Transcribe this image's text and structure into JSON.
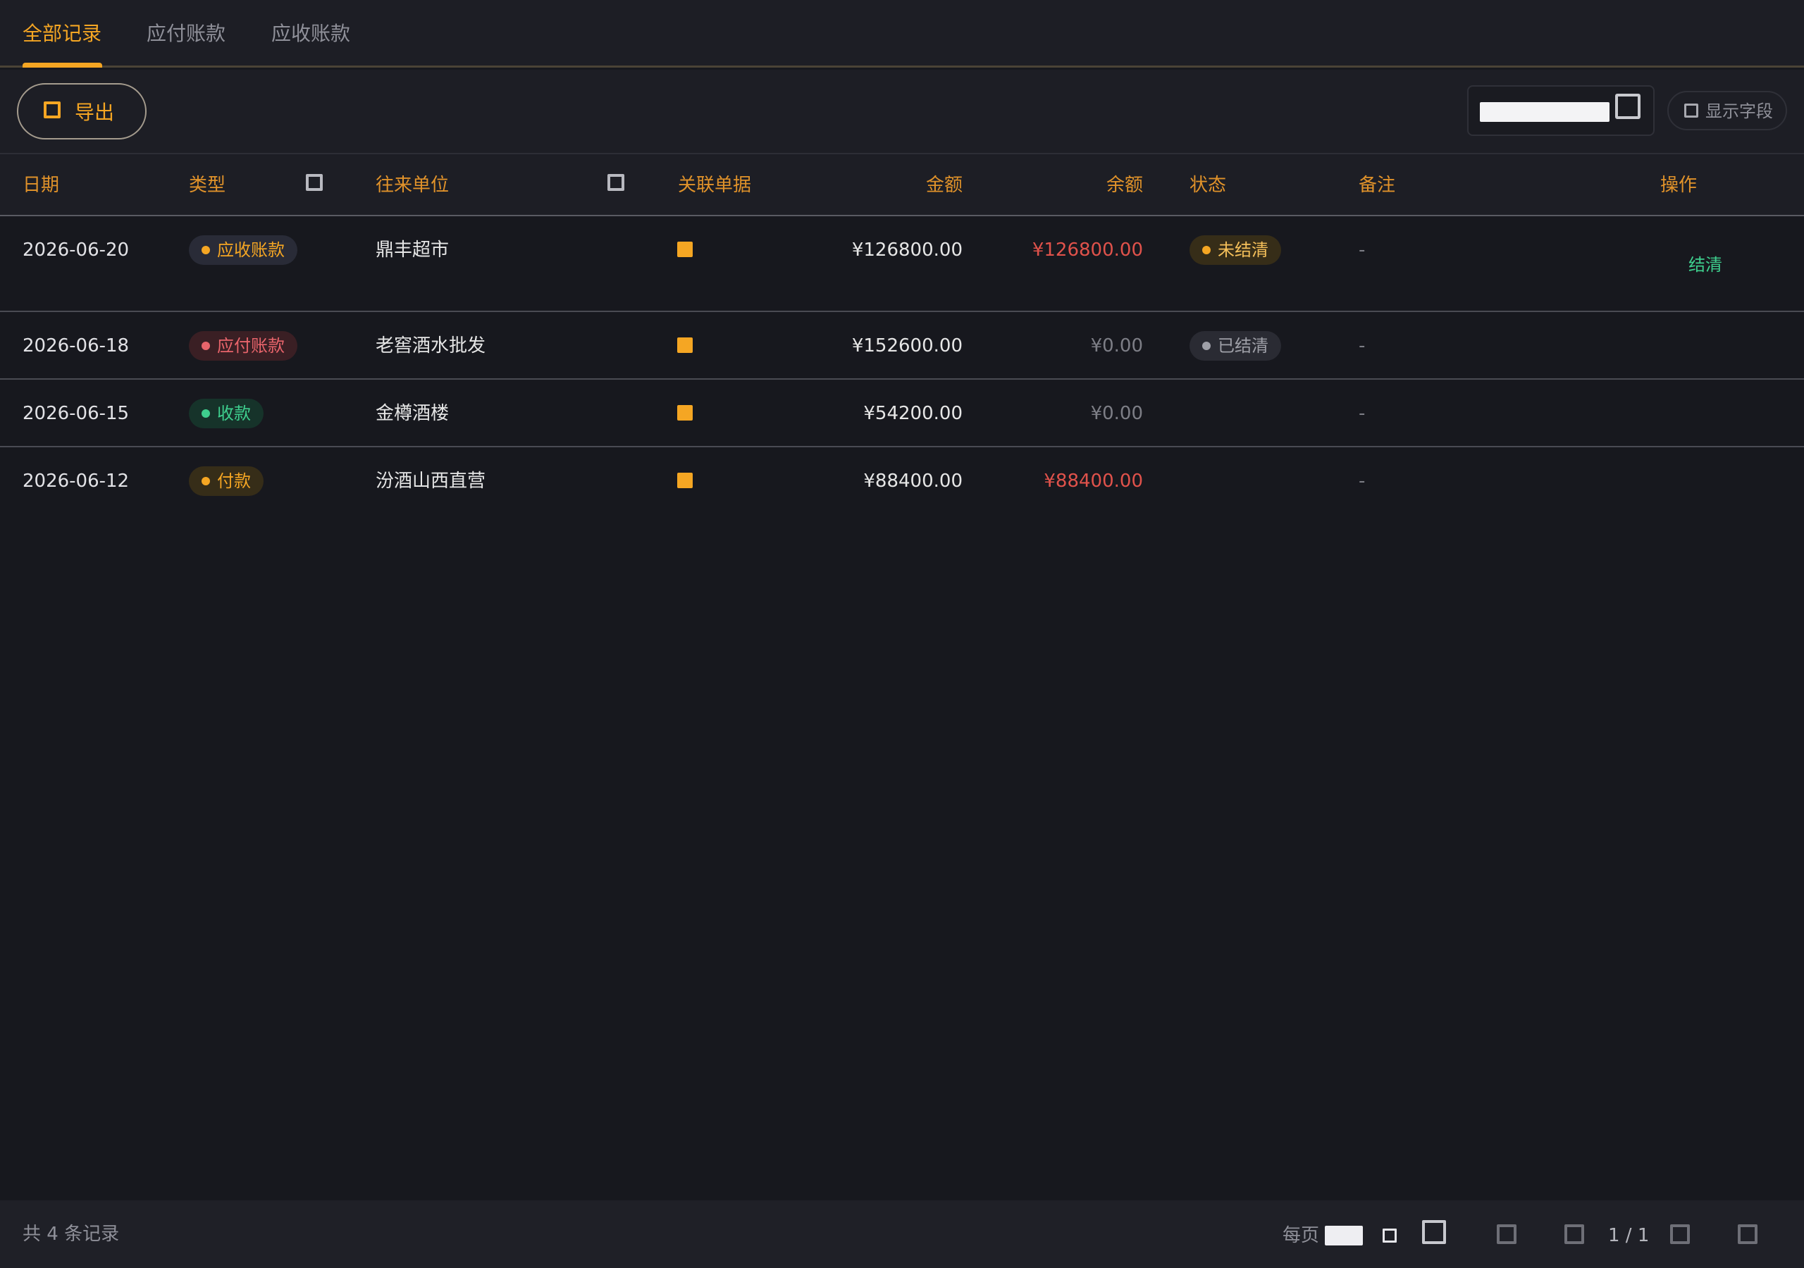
{
  "tabs": [
    {
      "label": "全部记录",
      "active": true
    },
    {
      "label": "应付账款",
      "active": false
    },
    {
      "label": "应收账款",
      "active": false
    }
  ],
  "toolbar": {
    "export_label": "导出",
    "search_value": "",
    "fields_label": "显示字段"
  },
  "table": {
    "headers": {
      "date": "日期",
      "type": "类型",
      "partner": "往来单位",
      "doc": "关联单据",
      "amount": "金额",
      "balance": "余额",
      "status": "状态",
      "remark": "备注",
      "action": "操作"
    },
    "rows": [
      {
        "date": "2026-06-20",
        "type": "应收账款",
        "partner": "鼎丰超市",
        "amount": "¥126800.00",
        "balance": "¥126800.00",
        "status": "未结清",
        "remark": "-",
        "action": "结清"
      },
      {
        "date": "2026-06-18",
        "type": "应付账款",
        "partner": "老窖酒水批发",
        "amount": "¥152600.00",
        "balance": "¥0.00",
        "status": "已结清",
        "remark": "-",
        "action": ""
      },
      {
        "date": "2026-06-15",
        "type": "收款",
        "partner": "金樽酒楼",
        "amount": "¥54200.00",
        "balance": "¥0.00",
        "status": "",
        "remark": "-",
        "action": ""
      },
      {
        "date": "2026-06-12",
        "type": "付款",
        "partner": "汾酒山西直营",
        "amount": "¥88400.00",
        "balance": "¥88400.00",
        "status": "",
        "remark": "-",
        "action": ""
      }
    ]
  },
  "footer": {
    "total_text": "共 4 条记录",
    "per_page_label": "每页",
    "page_text": "1 / 1"
  },
  "colors": {
    "accent": "#f5a623",
    "negative": "#e0524b",
    "positive": "#3ecf8e",
    "background": "#17181e"
  }
}
